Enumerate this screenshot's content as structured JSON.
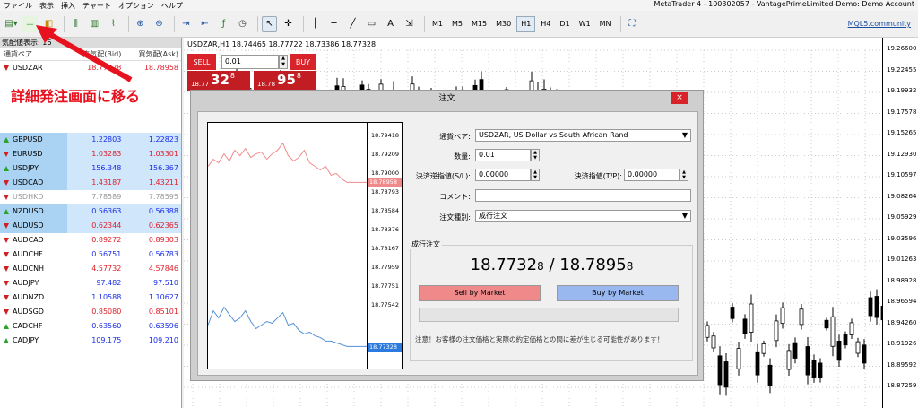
{
  "menu": [
    "ファイル",
    "表示",
    "挿入",
    "チャート",
    "オプション",
    "ヘルプ"
  ],
  "window_title": "MetaTrader 4 - 100302057 - VantagePrimeLimited-Demo: Demo Account",
  "toolbar": {
    "timeframes": [
      "M1",
      "M5",
      "M15",
      "M30",
      "H1",
      "H4",
      "D1",
      "W1",
      "MN"
    ],
    "active_timeframe": "H1",
    "mql5_link": "MQL5.community"
  },
  "watch": {
    "header": "気配値表示: 16",
    "col_pair": "通貨ペア",
    "col_bid": "売気配(Bid)",
    "col_ask": "買気配(Ask)",
    "rows": [
      {
        "pair": "USDZAR",
        "bid": "18.77328",
        "ask": "18.78958",
        "dir": "dn",
        "color": "red",
        "sel": false
      },
      {
        "pair": "",
        "bid": "",
        "ask": "",
        "dir": "",
        "color": "",
        "sel": false
      },
      {
        "pair": "",
        "bid": "",
        "ask": "",
        "dir": "",
        "color": "",
        "sel": false
      },
      {
        "pair": "",
        "bid": "",
        "ask": "",
        "dir": "",
        "color": "",
        "sel": false
      },
      {
        "pair": "",
        "bid": "",
        "ask": "",
        "dir": "",
        "color": "",
        "sel": false
      },
      {
        "pair": "GBPUSD",
        "bid": "1.22803",
        "ask": "1.22823",
        "dir": "up",
        "color": "blue",
        "sel": true
      },
      {
        "pair": "EURUSD",
        "bid": "1.03283",
        "ask": "1.03301",
        "dir": "dn",
        "color": "red",
        "sel": true
      },
      {
        "pair": "USDJPY",
        "bid": "156.348",
        "ask": "156.367",
        "dir": "up",
        "color": "blue",
        "sel": true
      },
      {
        "pair": "USDCAD",
        "bid": "1.43187",
        "ask": "1.43211",
        "dir": "dn",
        "color": "red",
        "sel": true
      },
      {
        "pair": "USDHKD",
        "bid": "7.78589",
        "ask": "7.78595",
        "dir": "dn",
        "color": "gray",
        "sel": false
      },
      {
        "pair": "NZDUSD",
        "bid": "0.56363",
        "ask": "0.56388",
        "dir": "up",
        "color": "blue",
        "sel": true
      },
      {
        "pair": "AUDUSD",
        "bid": "0.62344",
        "ask": "0.62365",
        "dir": "dn",
        "color": "red",
        "sel": true
      },
      {
        "pair": "AUDCAD",
        "bid": "0.89272",
        "ask": "0.89303",
        "dir": "dn",
        "color": "red",
        "sel": false
      },
      {
        "pair": "AUDCHF",
        "bid": "0.56751",
        "ask": "0.56783",
        "dir": "dn",
        "color": "blue",
        "sel": false
      },
      {
        "pair": "AUDCNH",
        "bid": "4.57732",
        "ask": "4.57846",
        "dir": "dn",
        "color": "red",
        "sel": false
      },
      {
        "pair": "AUDJPY",
        "bid": "97.482",
        "ask": "97.510",
        "dir": "dn",
        "color": "blue",
        "sel": false
      },
      {
        "pair": "AUDNZD",
        "bid": "1.10588",
        "ask": "1.10627",
        "dir": "dn",
        "color": "blue",
        "sel": false
      },
      {
        "pair": "AUDSGD",
        "bid": "0.85080",
        "ask": "0.85101",
        "dir": "dn",
        "color": "red",
        "sel": false
      },
      {
        "pair": "CADCHF",
        "bid": "0.63560",
        "ask": "0.63596",
        "dir": "up",
        "color": "blue",
        "sel": false
      },
      {
        "pair": "CADJPY",
        "bid": "109.175",
        "ask": "109.210",
        "dir": "up",
        "color": "blue",
        "sel": false
      }
    ]
  },
  "annotation": "詳細発注画面に移る",
  "chart": {
    "symbol_line": "USDZAR,H1  18.74465 18.77722 18.73386 18.77328",
    "y_labels": [
      "19.26600",
      "19.22455",
      "19.19932",
      "19.17578",
      "19.15265",
      "19.12930",
      "19.10597",
      "19.08264",
      "19.05929",
      "19.03596",
      "19.01263",
      "18.98928",
      "18.96594",
      "18.94260",
      "18.91926",
      "18.89592",
      "18.87259"
    ]
  },
  "oneclick": {
    "sell": "SELL",
    "buy": "BUY",
    "lot": "0.01",
    "sell_small": "18.77",
    "sell_big": "32",
    "sell_sup": "8",
    "buy_small": "18.78",
    "buy_big": "95",
    "buy_sup": "8"
  },
  "dialog": {
    "title": "注文",
    "close": "×",
    "mini_labels": [
      "18.79418",
      "18.79209",
      "18.79000",
      "18.78793",
      "18.78584",
      "18.78376",
      "18.78167",
      "18.77959",
      "18.77751",
      "18.77542"
    ],
    "ask_tag": "18.78958",
    "bid_tag": "18.77328",
    "symbol_label": "通貨ペア:",
    "symbol_value": "USDZAR, US Dollar vs South African Rand",
    "volume_label": "数量:",
    "volume_value": "0.01",
    "sl_label": "決済逆指値(S/L):",
    "sl_value": "0.00000",
    "tp_label": "決済指値(T/P):",
    "tp_value": "0.00000",
    "comment_label": "コメント:",
    "comment_value": "",
    "type_label": "注文種別:",
    "type_value": "成行注文",
    "group_label": "成行注文",
    "bid_main": "18.7732",
    "bid_small": "8",
    "sep": " / ",
    "ask_main": "18.7895",
    "ask_small": "8",
    "sell_by_market": "Sell by Market",
    "buy_by_market": "Buy by Market",
    "warning": "注意！お客様の注文価格と実際の約定価格との間に差が生じる可能性があります！"
  }
}
